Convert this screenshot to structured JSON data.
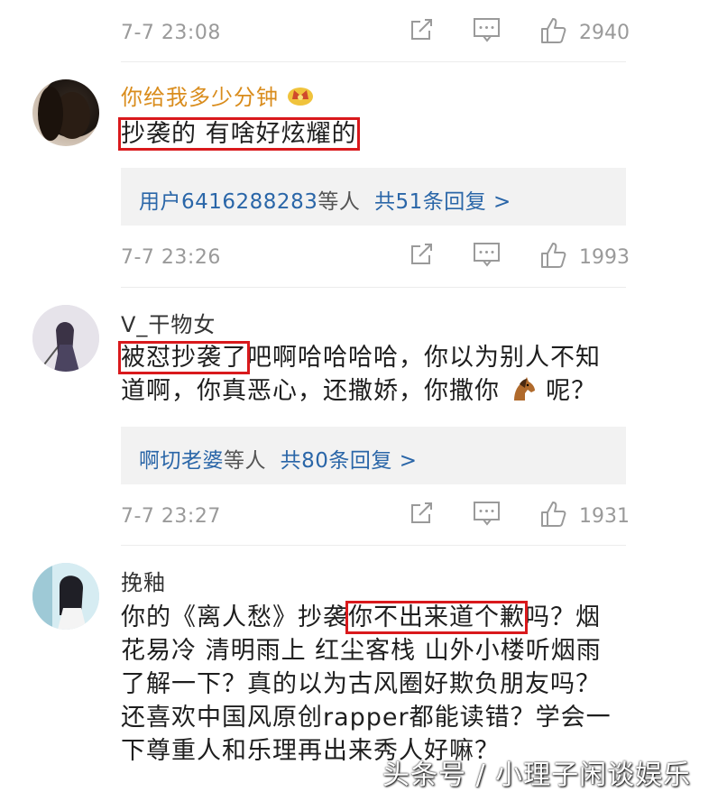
{
  "comments": [
    {
      "time": "7-7 23:08",
      "likes": "2940"
    },
    {
      "username": "你给我多少分钟",
      "badge": "crown-icon",
      "text_highlight": "抄袭的 有啥好炫耀的",
      "reply": {
        "users": "用户6416288283",
        "suffix": "等人",
        "count_text": "共51条回复 >"
      },
      "time": "7-7 23:26",
      "likes": "1993"
    },
    {
      "username": "V_干物女",
      "text_highlight": "被怼抄袭了",
      "text_rest1": "吧啊哈哈哈哈，你以为别人不知",
      "text_line2a": "道啊，你真恶心，还撒娇，你撒你",
      "text_line2b": "呢？",
      "reply": {
        "users": "啊切老婆",
        "suffix": "等人",
        "count_text": "共80条回复 >"
      },
      "time": "7-7 23:27",
      "likes": "1931"
    },
    {
      "username": "挽釉",
      "text_pre": "你的《离人愁》抄袭",
      "text_highlight": "你不出来道个歉",
      "text_post": "吗？烟",
      "line2": "花易冷 清明雨上 红尘客栈 山外小楼听烟雨",
      "line3": "了解一下？真的以为古风圈好欺负朋友吗？",
      "line4": "还喜欢中国风原创rapper都能读错？学会一",
      "line5": "下尊重人和乐理再出来秀人好嘛？"
    }
  ],
  "watermark": "头条号 / 小理子闲谈娱乐",
  "colors": {
    "username_gold": "#d98c1c",
    "link_blue": "#2a66a8",
    "highlight_red": "#d9191c"
  }
}
